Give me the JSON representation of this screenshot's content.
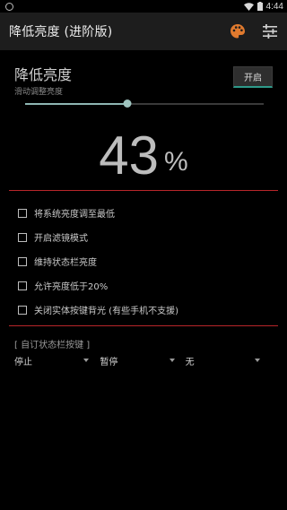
{
  "status_bar": {
    "time": "4:44",
    "icons": [
      "ring-icon",
      "wifi-icon",
      "battery-icon"
    ]
  },
  "app_bar": {
    "title": "降低亮度 (进阶版)",
    "icons": [
      "palette-icon",
      "settings-sliders-icon"
    ],
    "colors": {
      "background": "#1d1d1d",
      "palette_accent": "#e07a2e"
    }
  },
  "brightness": {
    "title": "降低亮度",
    "subtitle": "滑动调整亮度",
    "toggle_label": "开启",
    "slider_level": 0.43,
    "percent_value": "43",
    "percent_sign": "%"
  },
  "options": [
    {
      "label": "将系统亮度调至最低",
      "checked": false
    },
    {
      "label": "开启滤镜模式",
      "checked": false
    },
    {
      "label": "维持状态栏亮度",
      "checked": false
    },
    {
      "label": "允许亮度低于20%",
      "checked": false
    },
    {
      "label": "关闭实体按键背光 (有些手机不支援)",
      "checked": false
    }
  ],
  "custom_buttons": {
    "label": "[ 自订状态栏按键 ]",
    "dropdowns": [
      {
        "selected": "停止"
      },
      {
        "selected": "暂停"
      },
      {
        "selected": "无"
      }
    ]
  },
  "colors": {
    "divider": "#b8262a",
    "slider_accent": "#8fb7b3",
    "toggle_underline": "#2e9a8a"
  }
}
